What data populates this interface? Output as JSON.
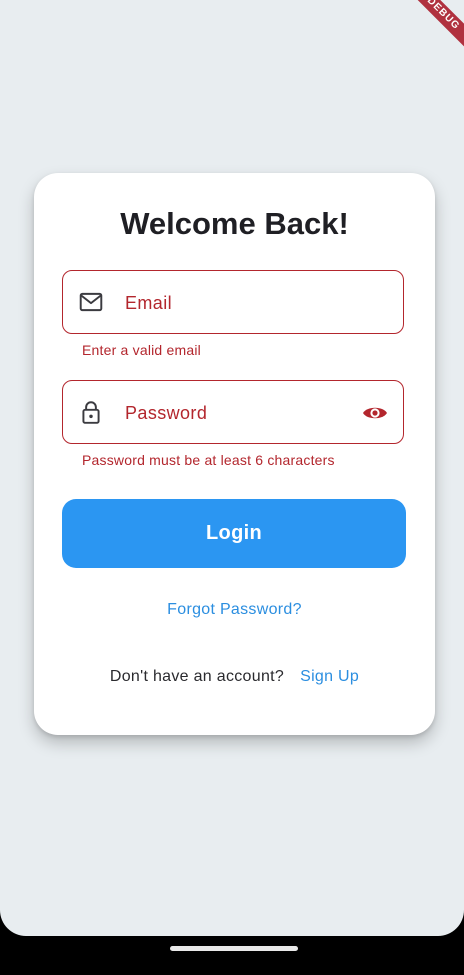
{
  "debug_banner": "DEBUG",
  "login_card": {
    "title": "Welcome Back!",
    "email_field": {
      "placeholder": "Email",
      "icon": "mail-icon",
      "error": "Enter a valid email"
    },
    "password_field": {
      "placeholder": "Password",
      "icon": "lock-icon",
      "toggle_icon": "eye-icon",
      "error": "Password must be at least 6 characters"
    },
    "login_button": "Login",
    "forgot_password": "Forgot Password?",
    "signup_prompt": "Don't have an account?",
    "signup_link": "Sign Up"
  },
  "colors": {
    "background": "#e8edf0",
    "card": "#ffffff",
    "error": "#b3262d",
    "primary": "#2b96f2",
    "link": "#2b8ee0",
    "title": "#1f1f24"
  }
}
